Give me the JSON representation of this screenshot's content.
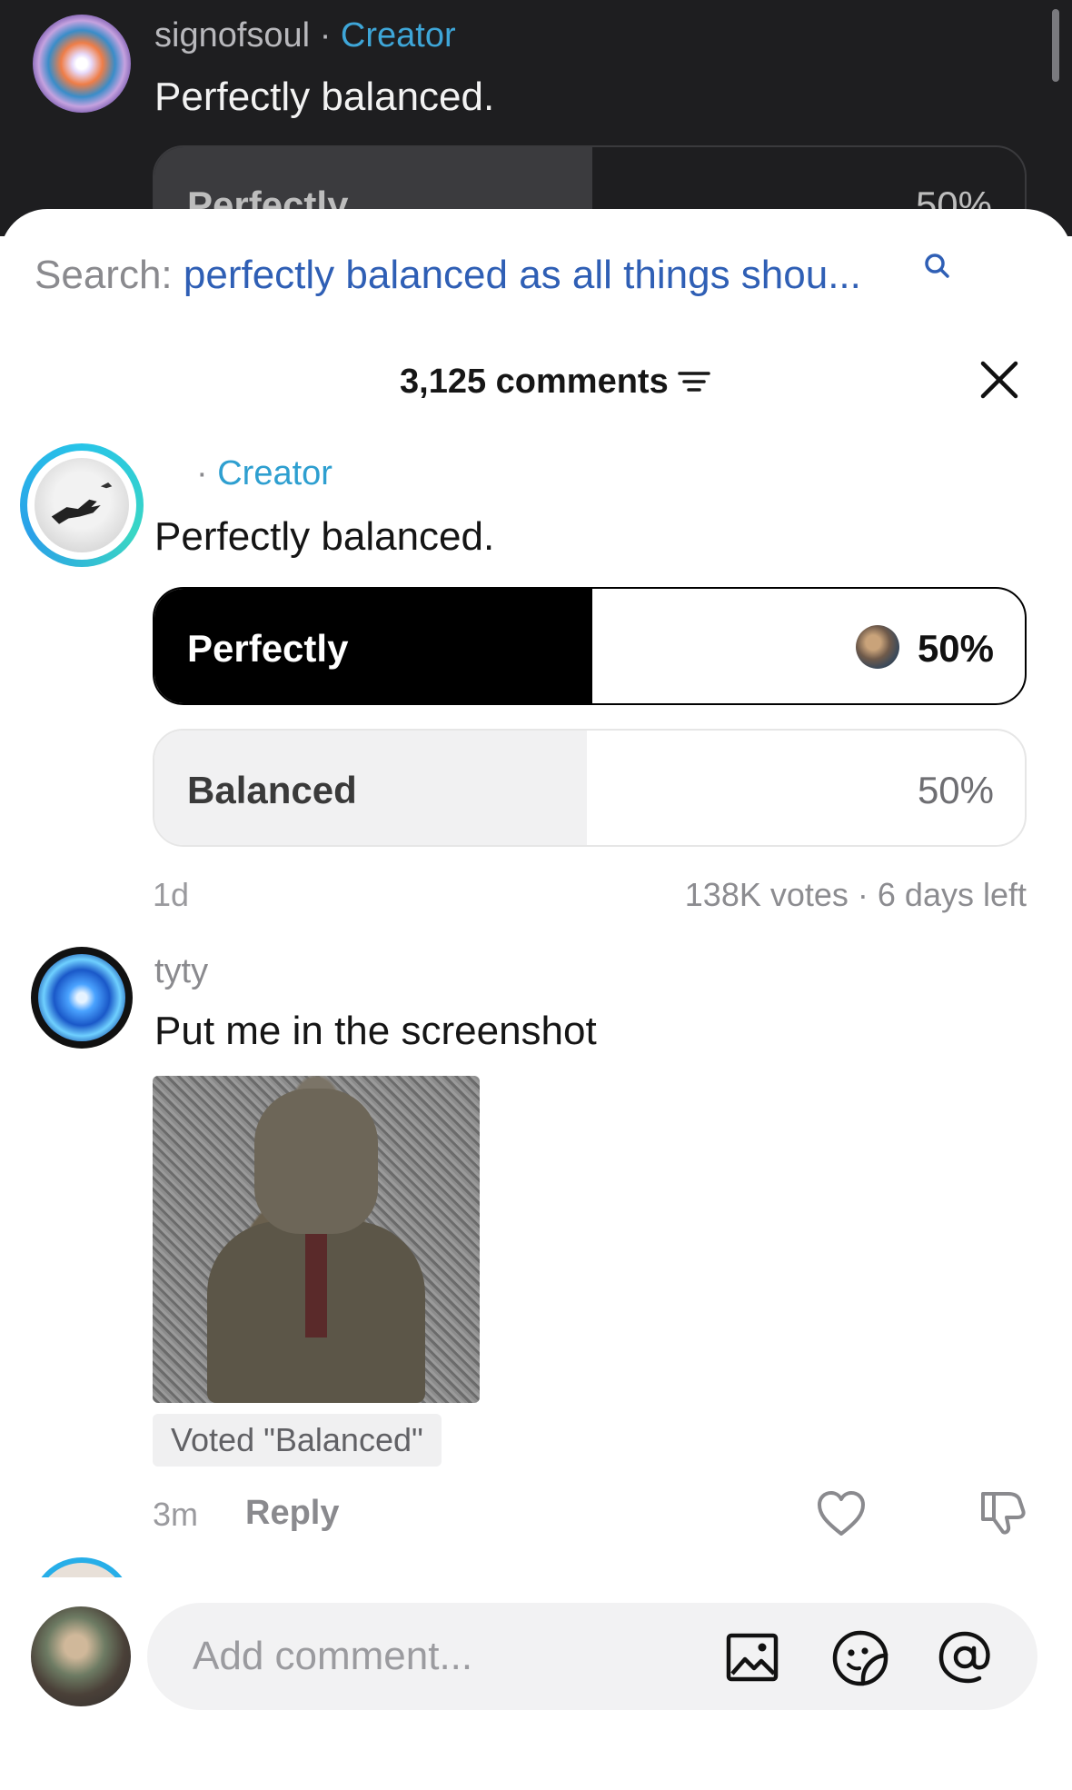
{
  "background_comment": {
    "username": "signofsoul",
    "separator": "·",
    "badge": "Creator",
    "text": "Perfectly balanced.",
    "poll_option_label": "Perfectly",
    "poll_option_pct": "50%"
  },
  "search": {
    "label": "Search:",
    "query": "perfectly balanced as all things shou..."
  },
  "header": {
    "comment_count": "3,125 comments"
  },
  "comments": [
    {
      "separator": "·",
      "badge": "Creator",
      "text": "Perfectly balanced.",
      "poll": {
        "options": [
          {
            "label": "Perfectly",
            "percent": "50%",
            "fraction": 0.5,
            "selected": true
          },
          {
            "label": "Balanced",
            "percent": "50%",
            "fraction": 0.5,
            "selected": false
          }
        ],
        "time": "1d",
        "votes_info": "138K votes · 6 days left"
      }
    },
    {
      "username": "tyty",
      "text": "Put me in the screenshot",
      "voted_badge": "Voted \"Balanced\"",
      "time": "3m",
      "reply_label": "Reply"
    }
  ],
  "composer": {
    "placeholder": "Add comment..."
  },
  "colors": {
    "creator_blue": "#2e9fd0",
    "search_query_blue": "#2f5fb5",
    "poll_selected_fill": "#000000",
    "poll_unselected_fill": "#f1f1f2"
  }
}
